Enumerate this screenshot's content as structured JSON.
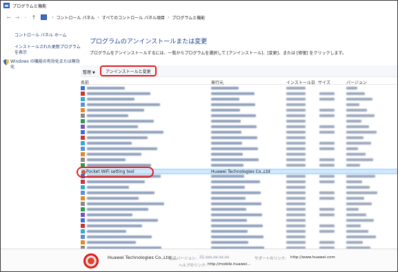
{
  "window": {
    "title": "プログラムと機能"
  },
  "address": {
    "crumbs": [
      "コントロール パネル",
      "すべてのコントロール パネル項目",
      "プログラムと機能"
    ]
  },
  "sidebar": {
    "home": "コントロール パネル ホーム",
    "installed_updates": "インストールされた更新プログラムを表示",
    "windows_features": "Windows の機能の有効化または無効化"
  },
  "main": {
    "title": "プログラムのアンインストールまたは変更",
    "description": "プログラムをアンインストールするには、一覧からプログラムを選択して [アンインストール]、[変更]、または [修復] をクリックします。"
  },
  "toolbar": {
    "organize": "整理",
    "uninstall_change": "アンインストールと変更"
  },
  "columns": {
    "name": "名前",
    "publisher": "発行元",
    "install_date": "インストール日",
    "size": "サイズ",
    "version": "バージョン"
  },
  "selected_program": {
    "name": "Pocket WiFi setting tool",
    "publisher": "Huawei Technologies Co.,Ltd"
  },
  "details": {
    "company": "Huawei Technologies Co.,Ltd",
    "product_version_label": "製品バージョン:",
    "support_link_label": "サポートのリンク:",
    "support_link": "http://www.huawei.com",
    "help_link_label": "ヘルプのリンク:",
    "help_link": "http://mobile.huawei..."
  },
  "colors": {
    "highlight_ring": "#e21b1b",
    "selection": "#cde8ff",
    "title_blue": "#1c3f94"
  }
}
